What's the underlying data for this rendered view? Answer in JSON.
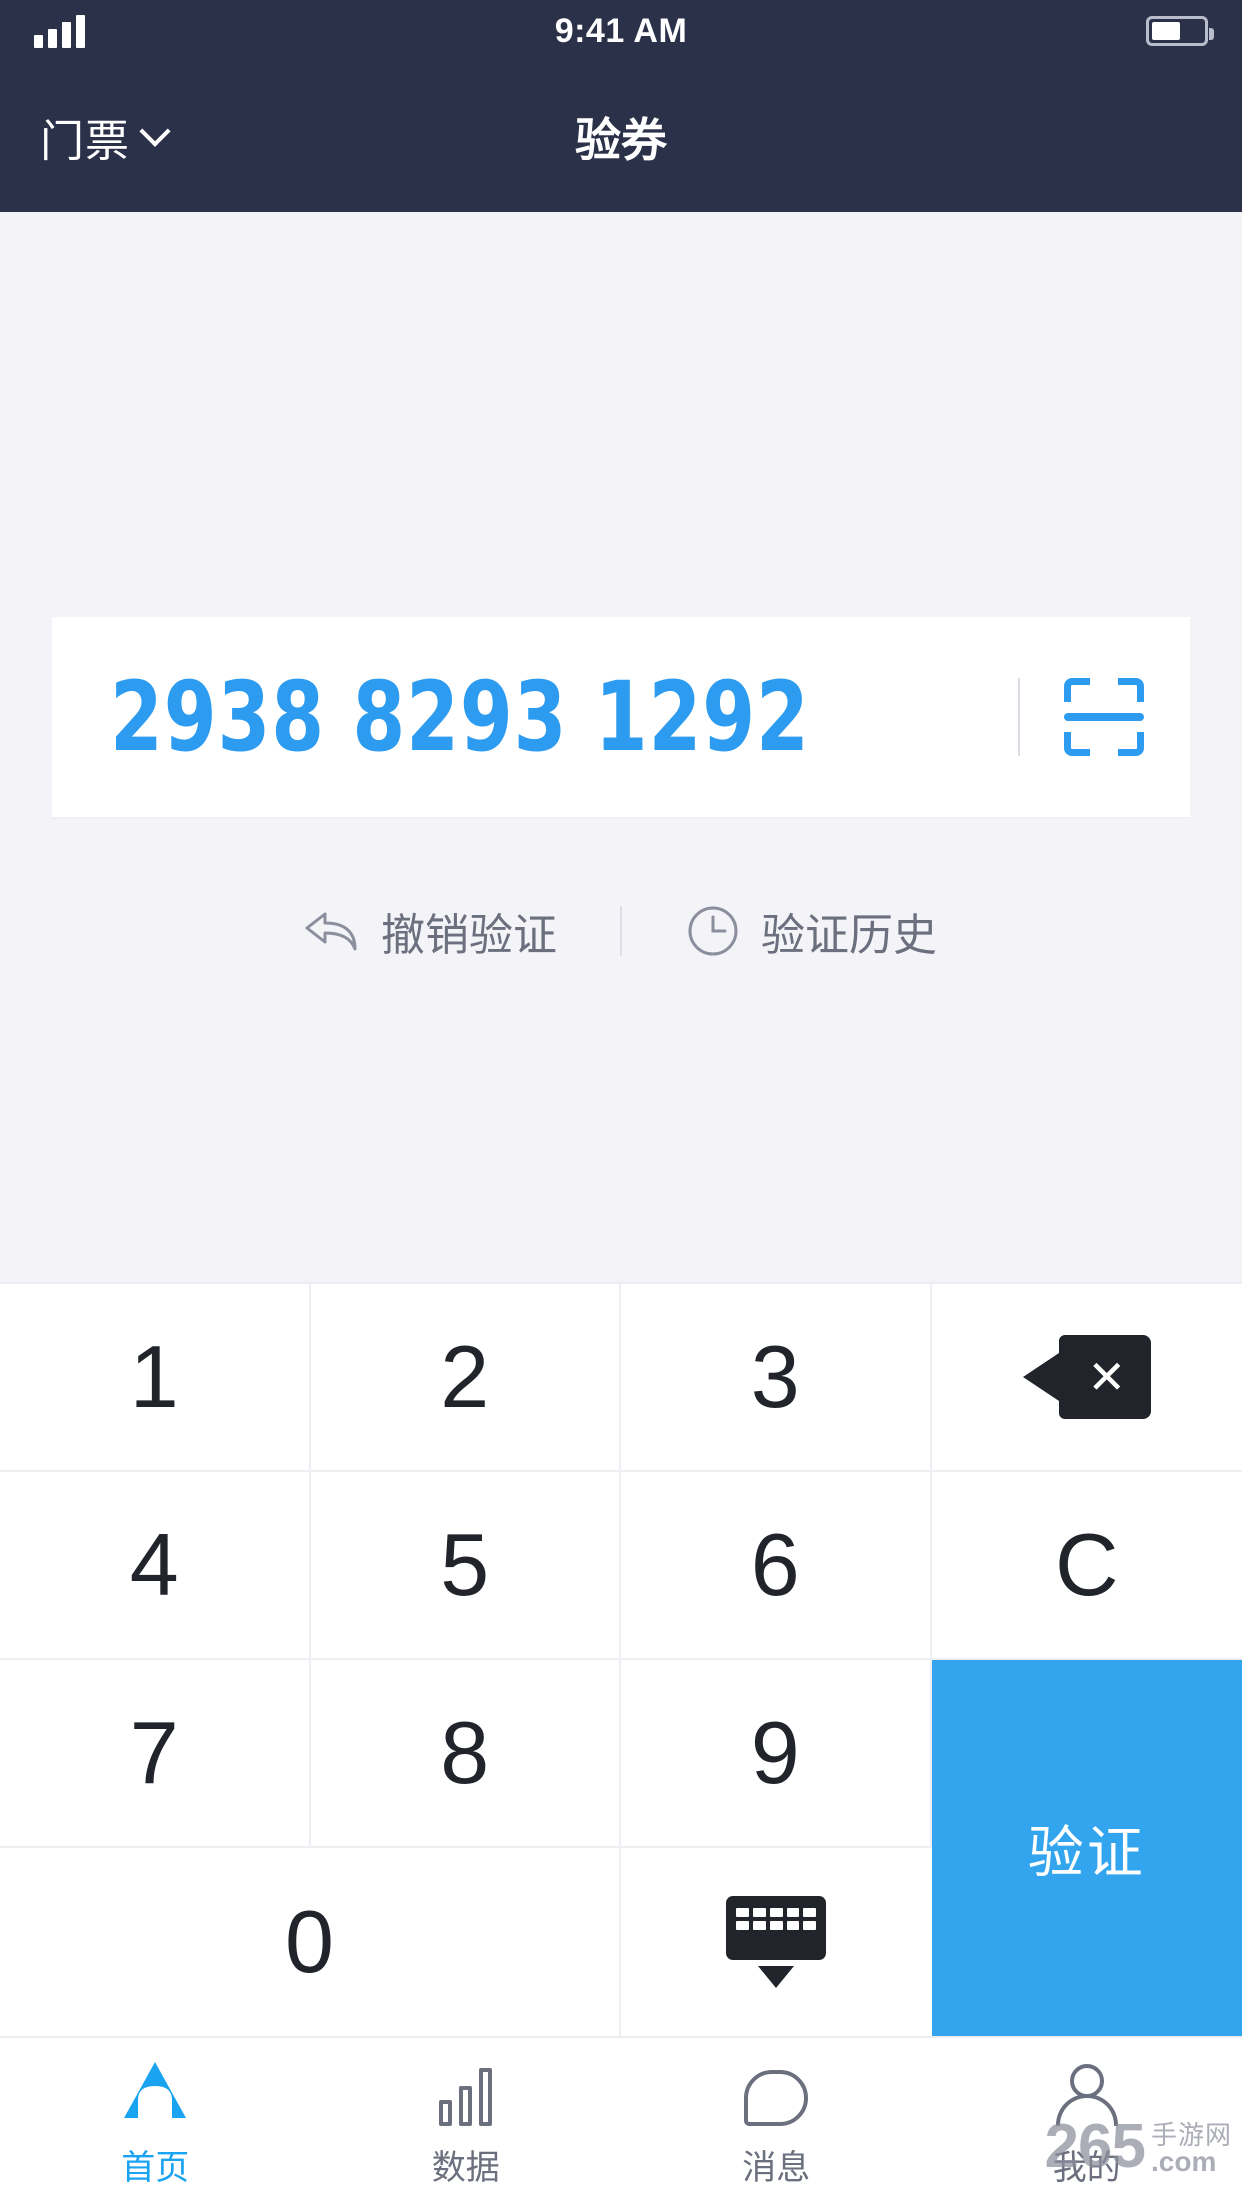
{
  "status_bar": {
    "time": "9:41 AM",
    "signal_icon": "signal-bars-icon",
    "battery_icon": "battery-icon",
    "battery_level": "55"
  },
  "nav_bar": {
    "left_label": "门票",
    "left_chevron_icon": "chevron-down-icon",
    "title": "验券"
  },
  "code_card": {
    "code": "2938 8293 1292",
    "scan_icon": "scan-qr-icon",
    "accent_color": "#2d9cf0"
  },
  "actions": [
    {
      "label": "撤销验证",
      "icon": "undo-arrow-icon"
    },
    {
      "label": "验证历史",
      "icon": "clock-icon"
    }
  ],
  "keypad": {
    "keys": [
      "1",
      "2",
      "3",
      "4",
      "5",
      "6",
      "7",
      "8",
      "9",
      "0"
    ],
    "backspace_icon": "backspace-delete-icon",
    "clear_label": "C",
    "keyboard_dismiss_icon": "keyboard-hide-icon",
    "verify_label": "验证",
    "verify_color": "#33a5ef"
  },
  "tab_bar": {
    "items": [
      {
        "label": "首页",
        "icon": "home-icon",
        "active": true
      },
      {
        "label": "数据",
        "icon": "bar-chart-icon",
        "active": false
      },
      {
        "label": "消息",
        "icon": "chat-bubble-icon",
        "active": false
      },
      {
        "label": "我的",
        "icon": "person-icon",
        "active": false
      }
    ],
    "active_color": "#1aa3f0"
  },
  "watermark": {
    "number": "265",
    "cn": "手游网",
    "domain": ".com"
  }
}
